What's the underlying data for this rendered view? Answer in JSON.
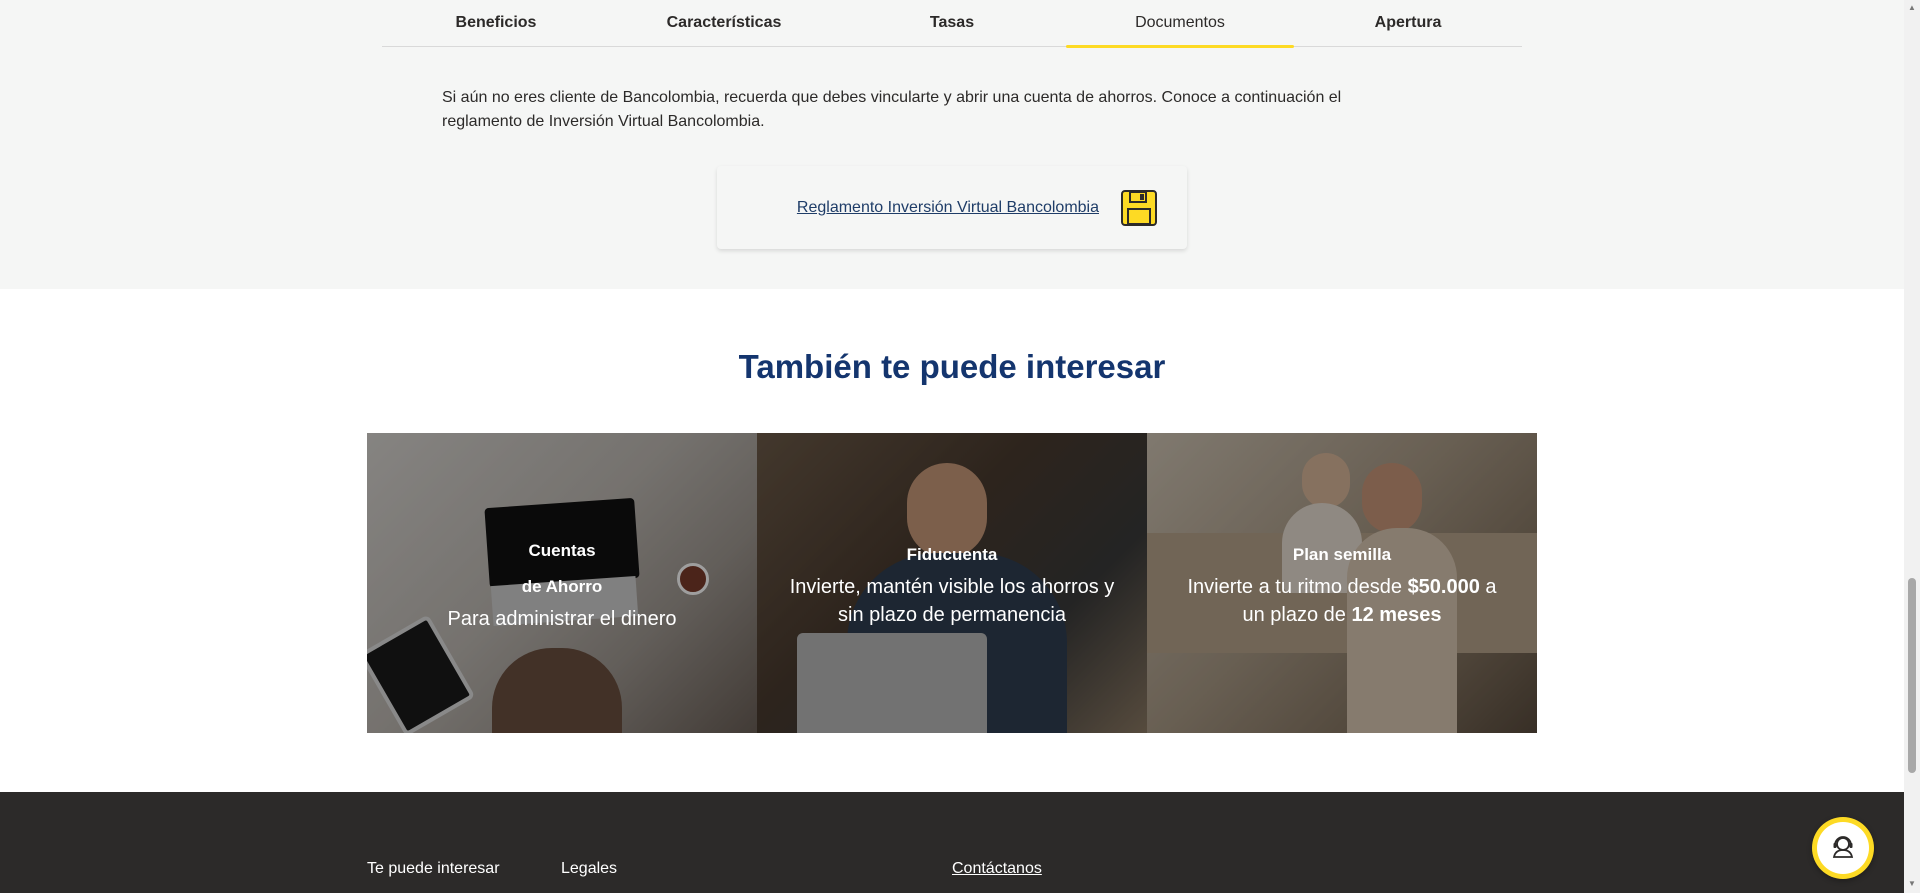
{
  "tabs": [
    {
      "label": "Beneficios",
      "active": false
    },
    {
      "label": "Características",
      "active": false
    },
    {
      "label": "Tasas",
      "active": false
    },
    {
      "label": "Documentos",
      "active": true
    },
    {
      "label": "Apertura",
      "active": false
    }
  ],
  "intro_text": "Si aún no eres cliente de Bancolombia, recuerda que debes vincularte y abrir una cuenta de ahorros. Conoce a continuación el reglamento de Inversión Virtual Bancolombia.",
  "document": {
    "link_label": "Reglamento Inversión Virtual Bancolombia",
    "icon": "save-icon"
  },
  "section_title": "También te puede interesar",
  "cards": [
    {
      "title_line1": "Cuentas",
      "title_line2": "de Ahorro",
      "desc": "Para administrar el dinero"
    },
    {
      "title": "Fiducuenta",
      "desc": "Invierte, mantén visible los ahorros y sin plazo de permanencia"
    },
    {
      "title": "Plan semilla",
      "desc_pre": "Invierte a tu ritmo desde ",
      "desc_bold1": "$50.000",
      "desc_mid": " a un plazo de ",
      "desc_bold2": "12 meses"
    }
  ],
  "footer": {
    "col1": "Te puede interesar",
    "col2": "Legales",
    "col3": "Contáctanos"
  },
  "chat": {
    "icon": "support-agent-icon"
  },
  "colors": {
    "accent": "#fdda24",
    "title_blue": "#14356e",
    "footer_bg": "#2c2a29"
  }
}
